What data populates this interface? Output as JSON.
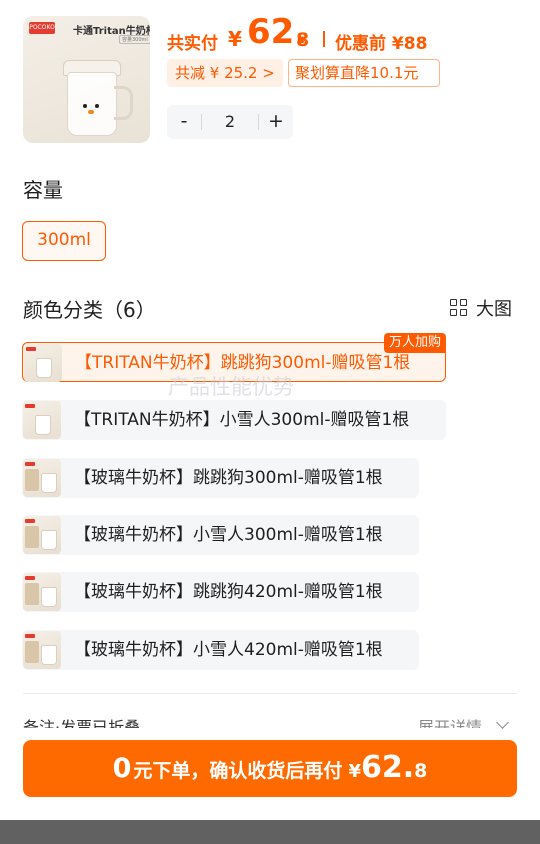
{
  "product": {
    "image_brand": "POCOKO",
    "image_title": "卡通Tritan牛奶杯",
    "image_subtitle": "容量300ml",
    "total_label": "共实付",
    "currency": "¥",
    "price_int": "62.",
    "price_dec": "8",
    "before_label": "优惠前 ¥88",
    "discount_tag": "共减 ¥ 25.2 >",
    "promo_tag": "聚划算直降10.1元"
  },
  "quantity": {
    "minus": "-",
    "value": "2",
    "plus": "+"
  },
  "capacity": {
    "title": "容量",
    "options": [
      "300ml"
    ],
    "selected": "300ml"
  },
  "colors": {
    "title": "颜色分类（6）",
    "view_toggle": "大图",
    "popular_badge": "万人加购",
    "watermark": "产品性能优势",
    "items": [
      {
        "label": "【TRITAN牛奶杯】跳跳狗300ml-赠吸管1根",
        "selected": true
      },
      {
        "label": "【TRITAN牛奶杯】小雪人300ml-赠吸管1根",
        "selected": false
      },
      {
        "label": "【玻璃牛奶杯】跳跳狗300ml-赠吸管1根",
        "selected": false
      },
      {
        "label": "【玻璃牛奶杯】小雪人300ml-赠吸管1根",
        "selected": false
      },
      {
        "label": "【玻璃牛奶杯】跳跳狗420ml-赠吸管1根",
        "selected": false
      },
      {
        "label": "【玻璃牛奶杯】小雪人420ml-赠吸管1根",
        "selected": false
      }
    ]
  },
  "footer": {
    "remarks": "备注·发票已折叠",
    "expand": "展开详情",
    "cta_zero": "0",
    "cta_text": "元下单，确认收货后再付",
    "cta_currency": "¥",
    "cta_int": "62.",
    "cta_dec": "8"
  },
  "colors_theme": {
    "accent": "#ff5a00",
    "cta": "#ff6a00",
    "chip_bg": "#f5f6f8"
  },
  "icons": [
    "grid-view-icon",
    "chevron-down-icon"
  ]
}
